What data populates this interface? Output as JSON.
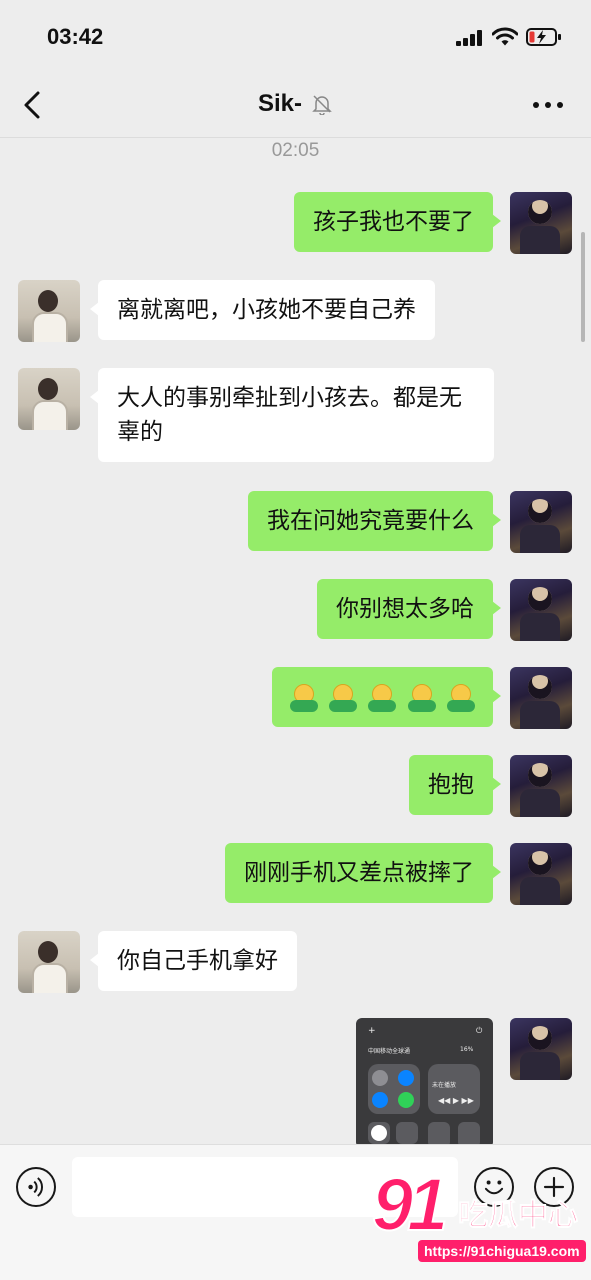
{
  "status_bar": {
    "time": "03:42",
    "icons": [
      "signal-icon",
      "wifi-icon",
      "battery-charging-icon"
    ]
  },
  "nav": {
    "back_icon": "chevron-left-icon",
    "title": "Sik-",
    "mute_icon": "bell-muted-icon",
    "more_icon": "more-dots-icon"
  },
  "chat": {
    "timestamp": "02:05",
    "messages": [
      {
        "from": "self",
        "type": "text",
        "text": "孩子我也不要了"
      },
      {
        "from": "other",
        "type": "text",
        "text": "离就离吧，小孩她不要自己养"
      },
      {
        "from": "other",
        "type": "text",
        "text": "大人的事别牵扯到小孩去。都是无辜的"
      },
      {
        "from": "self",
        "type": "text",
        "text": "我在问她究竟要什么"
      },
      {
        "from": "self",
        "type": "text",
        "text": "你别想太多哈"
      },
      {
        "from": "self",
        "type": "emoji",
        "emoji": "hug-emoji",
        "count": 5
      },
      {
        "from": "self",
        "type": "text",
        "text": "抱抱"
      },
      {
        "from": "self",
        "type": "text",
        "text": "刚刚手机又差点被摔了"
      },
      {
        "from": "other",
        "type": "text",
        "text": "你自己手机拿好"
      },
      {
        "from": "self",
        "type": "image",
        "image": "control-center-screenshot",
        "carrier": "中国移动全球通",
        "battery": "16%",
        "now_playing": "未在播放"
      }
    ]
  },
  "input_bar": {
    "voice_icon": "voice-icon",
    "emoji_icon": "emoji-icon",
    "plus_icon": "plus-icon",
    "text_value": ""
  },
  "watermark": {
    "logo_number": "91",
    "logo_text": "吃瓜中心",
    "url": "https://91chigua19.com"
  },
  "colors": {
    "background": "#ededed",
    "self_bubble": "#95ec69",
    "other_bubble": "#ffffff",
    "watermark": "#ff1f6b"
  }
}
